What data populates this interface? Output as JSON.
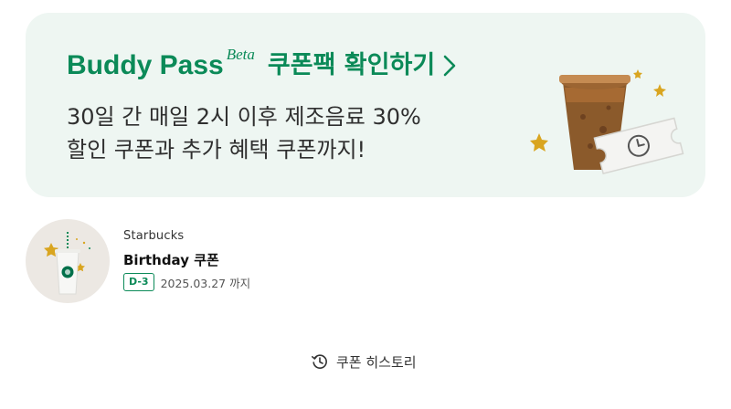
{
  "banner": {
    "title_main": "Buddy Pass",
    "title_beta": "Beta",
    "cta": "쿠폰팩 확인하기",
    "description_line1": "30일 간 매일 2시 이후 제조음료 30%",
    "description_line2": "할인 쿠폰과 추가 혜택 쿠폰까지!"
  },
  "coupon": {
    "brand": "Starbucks",
    "name": "Birthday 쿠폰",
    "dday": "D-3",
    "expire": "2025.03.27 까지"
  },
  "history": {
    "label": "쿠폰 히스토리",
    "icon": "history-icon"
  },
  "colors": {
    "brand_green": "#0b8a58",
    "banner_bg": "#eef6f2",
    "star_gold": "#d9a520"
  }
}
